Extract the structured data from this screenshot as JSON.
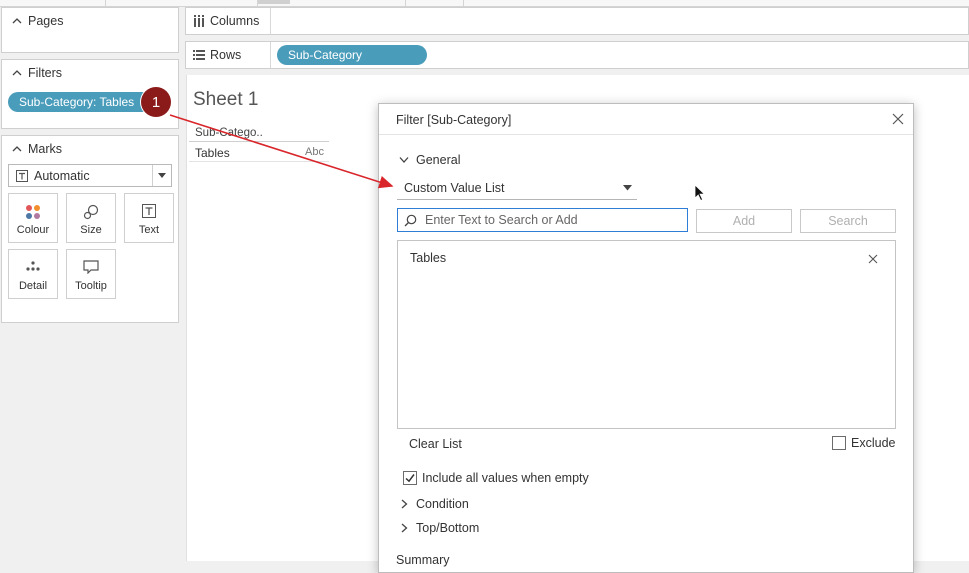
{
  "left_panel": {
    "pages": {
      "title": "Pages"
    },
    "filters": {
      "title": "Filters",
      "pill": "Sub-Category: Tables"
    },
    "marks": {
      "title": "Marks",
      "mark_type": "Automatic",
      "buttons": [
        "Colour",
        "Size",
        "Text",
        "Detail",
        "Tooltip"
      ]
    }
  },
  "shelves": {
    "columns_label": "Columns",
    "rows_label": "Rows",
    "rows_pill": "Sub-Category"
  },
  "sheet": {
    "title": "Sheet 1",
    "column_header": "Sub-Catego..",
    "row_value": "Tables",
    "placeholder": "Abc"
  },
  "annotation": {
    "badge": "1",
    "color": "#8b1a1a",
    "arrow_color": "#d9262b"
  },
  "dialog": {
    "title": "Filter [Sub-Category]",
    "section_general": "General",
    "mode_select": "Custom Value List",
    "search_placeholder": "Enter Text to Search or Add",
    "add_button": "Add",
    "search_button": "Search",
    "list_items": [
      "Tables"
    ],
    "clear_list": "Clear List",
    "exclude_label": "Exclude",
    "exclude_checked": false,
    "include_all_label": "Include all values when empty",
    "include_all_checked": true,
    "section_condition": "Condition",
    "section_topbottom": "Top/Bottom",
    "summary_label": "Summary"
  },
  "colors": {
    "pill": "#4a9cbb",
    "focus": "#2e7dd6"
  }
}
